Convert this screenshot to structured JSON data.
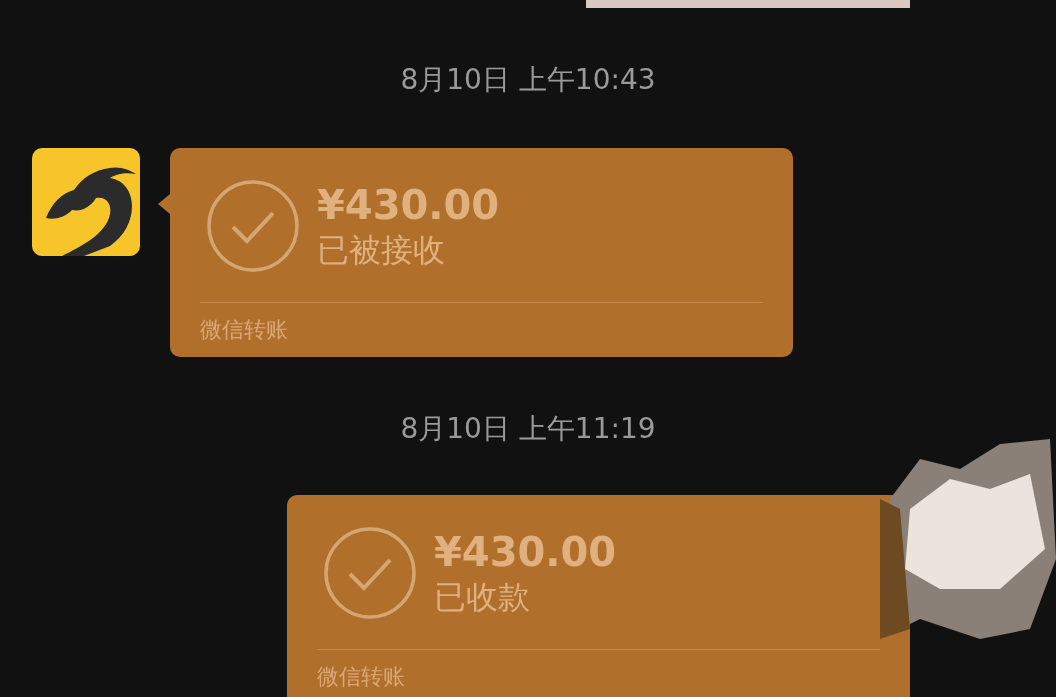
{
  "messages": [
    {
      "kind": "timestamp",
      "text": "8月10日 上午10:43"
    },
    {
      "kind": "transfer_in",
      "amount": "¥430.00",
      "status": "已被接收",
      "footer": "微信转账"
    },
    {
      "kind": "timestamp",
      "text": "8月10日 上午11:19"
    },
    {
      "kind": "transfer_out",
      "amount": "¥430.00",
      "status": "已收款",
      "footer": "微信转账",
      "avatar_scribbled": true
    }
  ]
}
